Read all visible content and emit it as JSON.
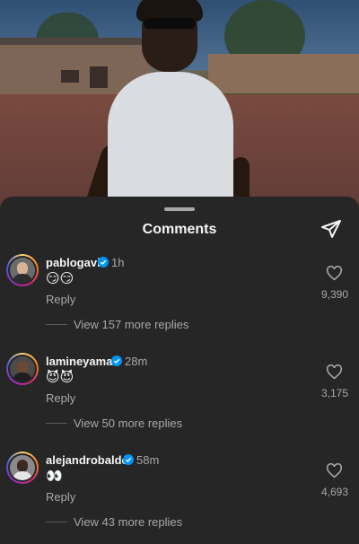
{
  "sheet": {
    "title": "Comments",
    "share_icon": "paper-plane-icon"
  },
  "comments": [
    {
      "username": "pablogavi",
      "verified": true,
      "time": "1h",
      "text": "😏😏",
      "reply_label": "Reply",
      "view_more": "View 157 more replies",
      "likes": "9,390"
    },
    {
      "username": "lamineyamal",
      "verified": true,
      "time": "28m",
      "text": "😈😈",
      "reply_label": "Reply",
      "view_more": "View 50 more replies",
      "likes": "3,175"
    },
    {
      "username": "alejandrobalde",
      "verified": true,
      "time": "58m",
      "text": "👀",
      "reply_label": "Reply",
      "view_more": "View 43 more replies",
      "likes": "4,693"
    }
  ],
  "colors": {
    "background": "#262626",
    "text": "#f5f5f5",
    "secondary_text": "#a8a8a8",
    "verified_badge": "#0095f6"
  }
}
